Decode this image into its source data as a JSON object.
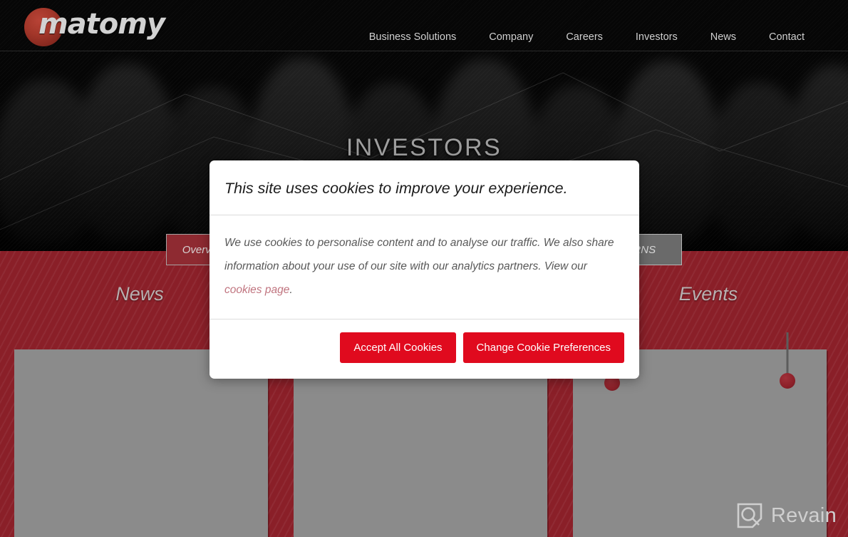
{
  "header": {
    "logo_text": "matomy",
    "logo_icon": "matomy-circle-logo",
    "nav": [
      {
        "label": "Business Solutions"
      },
      {
        "label": "Company"
      },
      {
        "label": "Careers"
      },
      {
        "label": "Investors"
      },
      {
        "label": "News"
      },
      {
        "label": "Contact"
      }
    ]
  },
  "hero": {
    "title": "INVESTORS"
  },
  "tabs": [
    {
      "label": "Overview",
      "style": "red"
    },
    {
      "label": "RNS",
      "style": "grey"
    }
  ],
  "sections": {
    "news_title": "News",
    "events_title": "Events"
  },
  "watermark": {
    "text": "Revain",
    "icon": "revain-logo-icon"
  },
  "cookie_dialog": {
    "title": "This site uses cookies to improve your experience.",
    "body_before_link": "We use cookies to personalise content and to analyse our traffic. We also share information about your use of our site with our analytics partners. View our ",
    "link_text": "cookies page",
    "body_after_link": ".",
    "accept_label": "Accept All Cookies",
    "preferences_label": "Change Cookie Preferences"
  },
  "colors": {
    "brand_red": "#8a1f28",
    "button_red": "#e00a1e",
    "card_grey": "#8b8b8b",
    "link_rose": "#c0747f",
    "nav_text": "#cfcfcf"
  }
}
